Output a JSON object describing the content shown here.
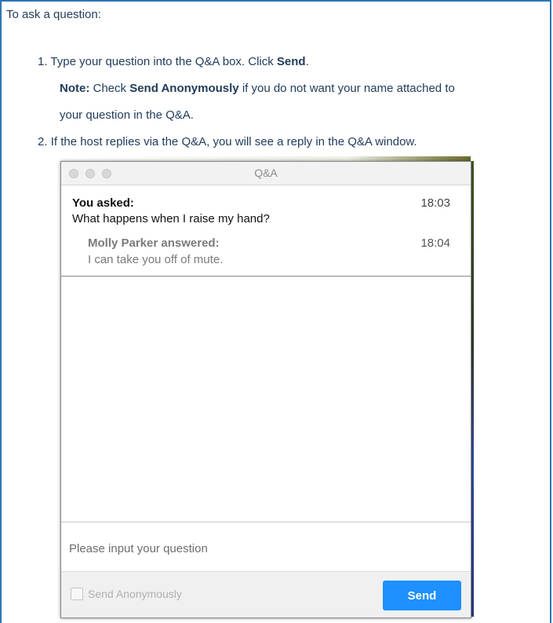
{
  "intro": "To ask a question:",
  "steps": {
    "step1_num": "1.",
    "step1_text_a": "Type your question into the Q&A box. Click ",
    "step1_bold": "Send",
    "step1_text_b": ".",
    "note_label": "Note:",
    "note_text_a": " Check ",
    "note_bold": "Send Anonymously",
    "note_text_b": " if you do not want your name attached to",
    "note_line2": "your question in the Q&A.",
    "step2_num": "2.",
    "step2_text": "If the host replies via the Q&A, you will see a reply in the Q&A window."
  },
  "window": {
    "title": "Q&A",
    "question": {
      "author": "You asked:",
      "time": "18:03",
      "text": "What happens when I raise my hand?"
    },
    "answer": {
      "author": "Molly Parker answered:",
      "time": "18:04",
      "text": "I can take you off of mute."
    },
    "input_placeholder": "Please input your question",
    "anonymous_label": "Send Anonymously",
    "anonymous_checked": false,
    "send_label": "Send"
  },
  "colors": {
    "accent": "#1e90ff",
    "frame": "#2e75b6",
    "text": "#1f3b5a"
  }
}
